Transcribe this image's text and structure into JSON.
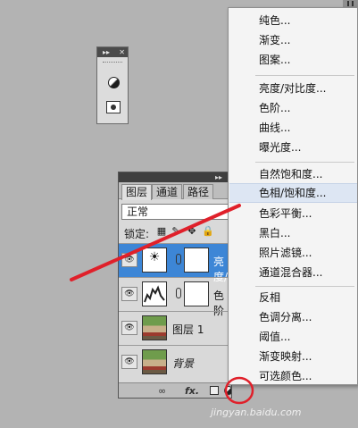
{
  "mini_palette": {
    "arrows": "▸▸",
    "close": "✕"
  },
  "layers_panel": {
    "tabs": [
      "图层",
      "通道",
      "路径"
    ],
    "blend_mode": "正常",
    "lock_label": "锁定:",
    "rows": [
      {
        "name": "亮度/",
        "thumb": "adjustment",
        "selected": true
      },
      {
        "name": "色阶",
        "thumb": "levels",
        "selected": false
      },
      {
        "name": "图层 1",
        "thumb": "photo",
        "selected": false
      },
      {
        "name": "背景",
        "thumb": "photo",
        "selected": false
      }
    ],
    "footer": {
      "link": "∞",
      "fx": "fx."
    }
  },
  "adjustment_menu": {
    "items": [
      "纯色...",
      "渐变...",
      "图案...",
      "亮度/对比度...",
      "色阶...",
      "曲线...",
      "曝光度...",
      "自然饱和度...",
      "色相/饱和度...",
      "色彩平衡...",
      "黑白...",
      "照片滤镜...",
      "通道混合器...",
      "反相",
      "色调分离...",
      "阈值...",
      "渐变映射...",
      "可选颜色..."
    ],
    "highlighted": "色相/饱和度..."
  },
  "watermark": "jingyan.baidu.com",
  "colors": {
    "annotation_red": "#e0202a",
    "selection_blue": "#3d86d6",
    "menu_highlight": "#dde6f3"
  }
}
